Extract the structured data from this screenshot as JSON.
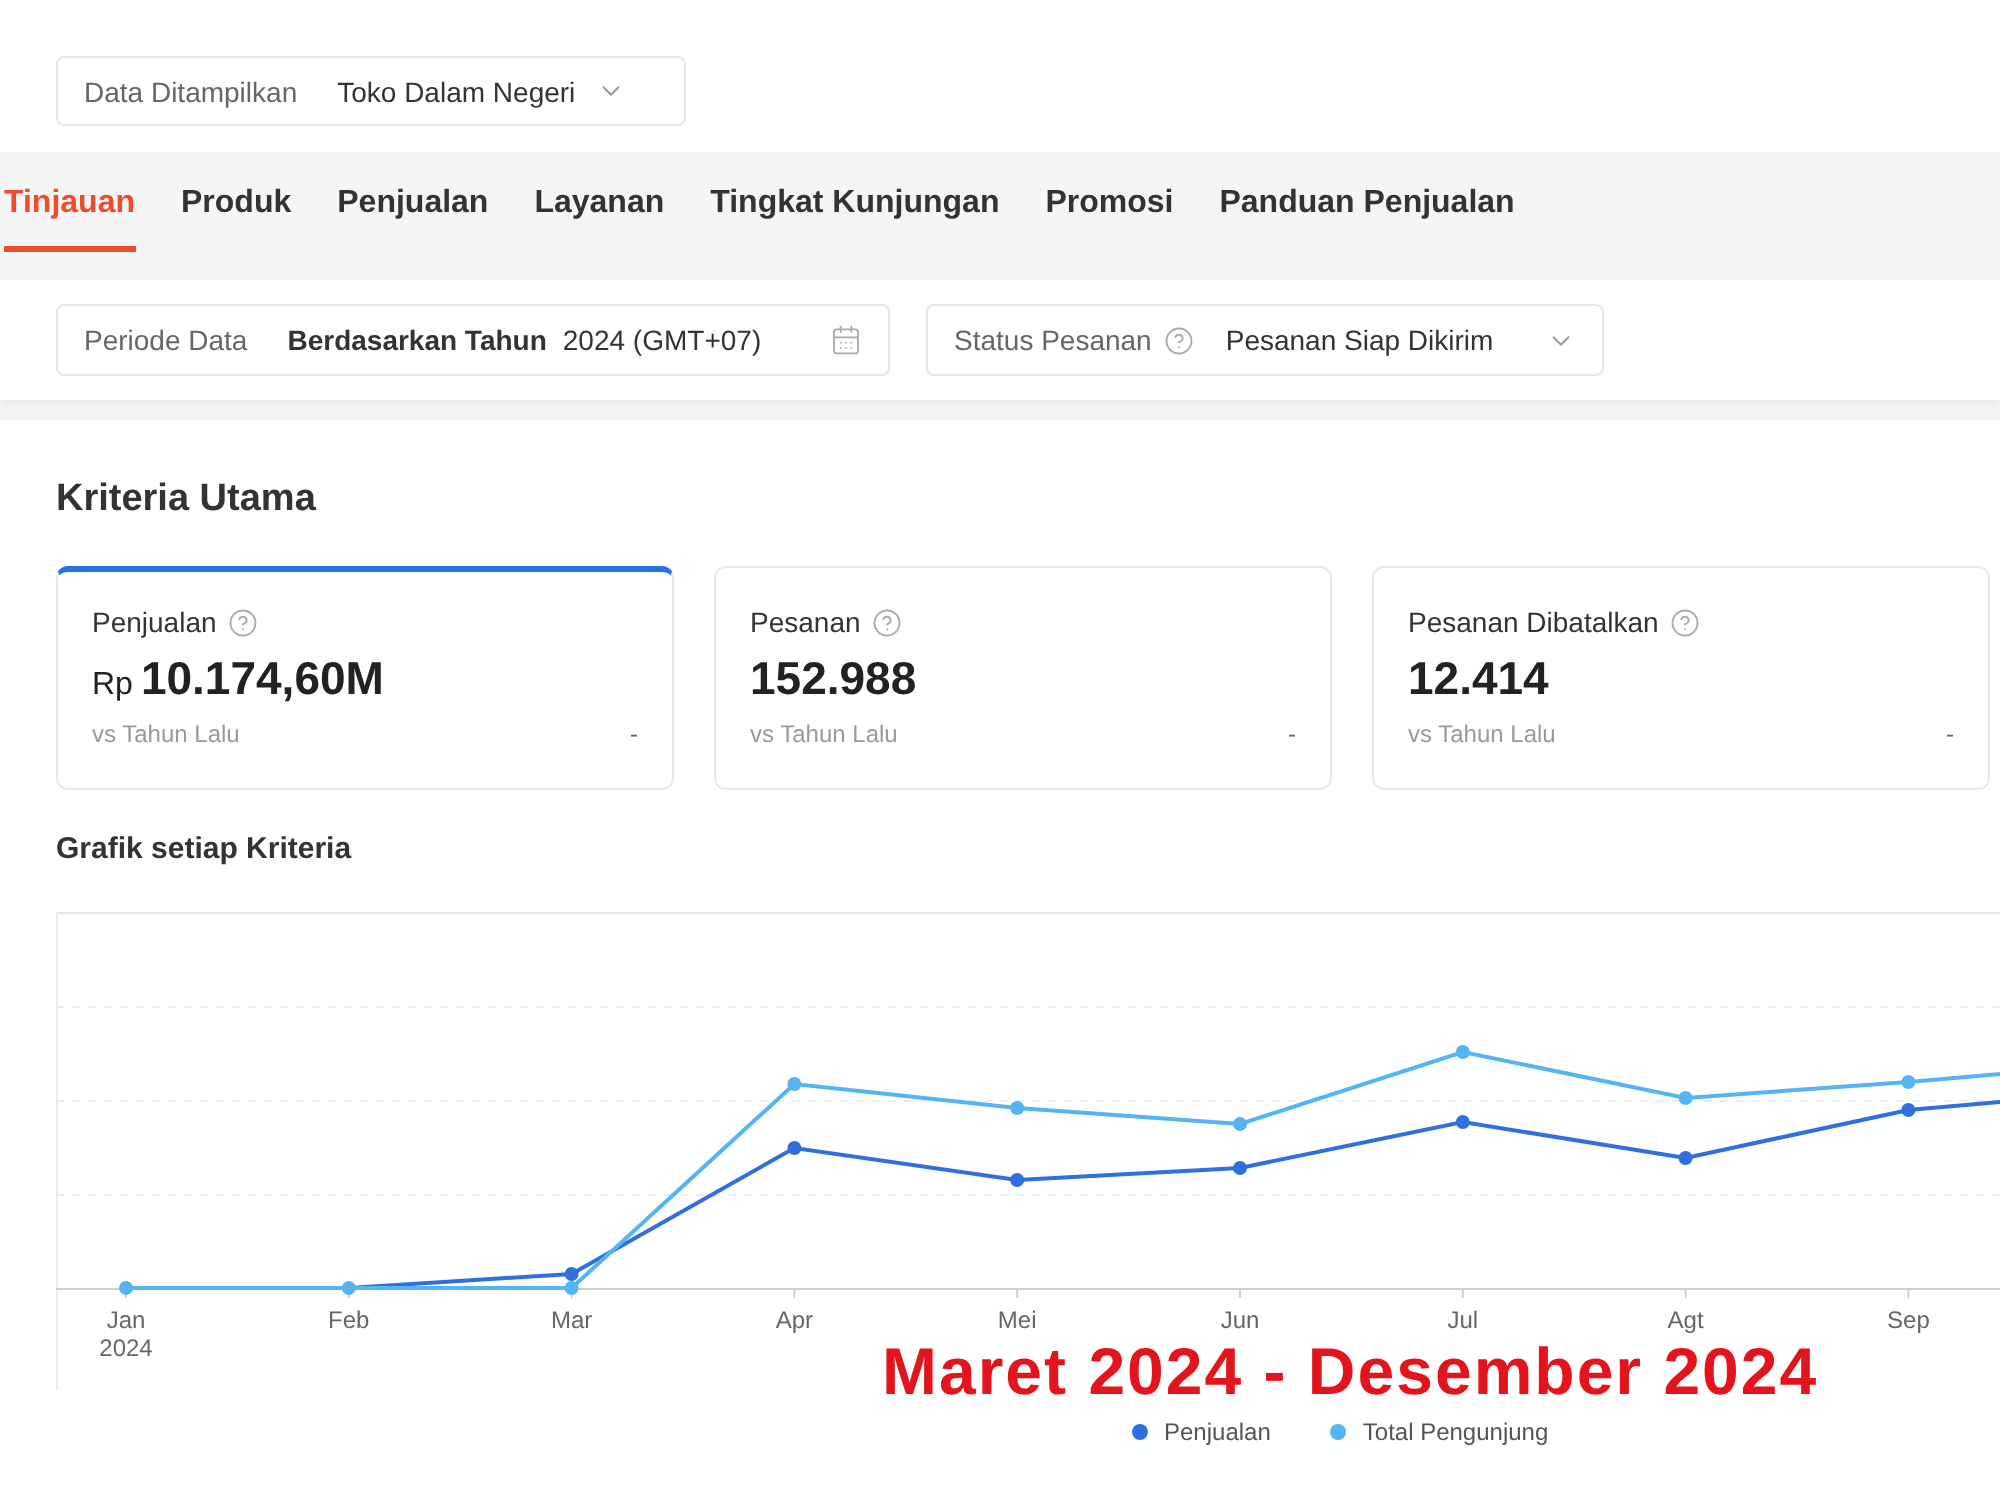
{
  "data_display": {
    "label": "Data Ditampilkan",
    "value": "Toko Dalam Negeri"
  },
  "tabs": [
    {
      "label": "Tinjauan",
      "selected": true
    },
    {
      "label": "Produk",
      "selected": false
    },
    {
      "label": "Penjualan",
      "selected": false
    },
    {
      "label": "Layanan",
      "selected": false
    },
    {
      "label": "Tingkat Kunjungan",
      "selected": false
    },
    {
      "label": "Promosi",
      "selected": false
    },
    {
      "label": "Panduan Penjualan",
      "selected": false
    }
  ],
  "filters": [
    {
      "kind": "date",
      "label": "Periode Data",
      "help": false,
      "mode": "Berdasarkan Tahun",
      "value": "2024 (GMT+07)"
    },
    {
      "kind": "select",
      "label": "Status Pesanan",
      "help": true,
      "value": "Pesanan Siap Dikirim"
    }
  ],
  "key_metrics": {
    "title": "Kriteria Utama",
    "cards": [
      {
        "label": "Penjualan",
        "help": true,
        "currency": "Rp",
        "value": "10.174,60M",
        "comparison": "vs Tahun Lalu",
        "change": "-",
        "selected": true
      },
      {
        "label": "Pesanan",
        "help": true,
        "value": "152.988",
        "comparison": "vs Tahun Lalu",
        "change": "-",
        "selected": false
      },
      {
        "label": "Pesanan Dibatalkan",
        "help": true,
        "value": "12.414",
        "comparison": "vs Tahun Lalu",
        "change": "-",
        "selected": false
      }
    ]
  },
  "chart_section": {
    "title": "Grafik setiap Kriteria",
    "x_labels": [
      {
        "label": "Jan",
        "sublabel": "2024"
      },
      {
        "label": "Feb"
      },
      {
        "label": "Mar"
      },
      {
        "label": "Apr"
      },
      {
        "label": "Mei"
      },
      {
        "label": "Jun"
      },
      {
        "label": "Jul"
      },
      {
        "label": "Agt"
      },
      {
        "label": "Sep"
      }
    ],
    "legend": [
      {
        "label": "Penjualan",
        "color": "#2f6fde"
      },
      {
        "label": "Total Pengunjung",
        "color": "#55b4f2"
      }
    ]
  },
  "annotation": "Maret 2024 - Desember 2024"
}
